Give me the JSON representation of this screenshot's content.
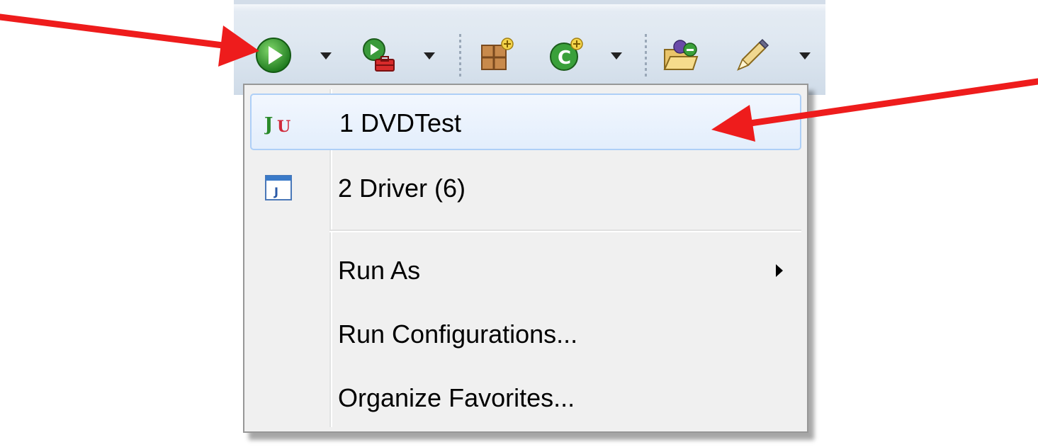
{
  "toolbar": {
    "buttons": [
      {
        "icon": "run-icon",
        "has_dropdown": true
      },
      {
        "icon": "external-tools-icon",
        "has_dropdown": true
      },
      {
        "icon": "new-package-icon",
        "has_dropdown": false
      },
      {
        "icon": "new-class-icon",
        "has_dropdown": true
      },
      {
        "icon": "open-type-icon",
        "has_dropdown": false
      },
      {
        "icon": "search-icon",
        "has_dropdown": true
      }
    ]
  },
  "menu": {
    "items": [
      {
        "label": "1 DVDTest",
        "icon": "junit-icon",
        "selected": true
      },
      {
        "label": "2 Driver (6)",
        "icon": "java-app-icon",
        "selected": false
      },
      {
        "label": "Run As",
        "has_submenu": true
      },
      {
        "label": "Run Configurations..."
      },
      {
        "label": "Organize Favorites..."
      }
    ]
  },
  "colors": {
    "selection_border": "#aecff7",
    "annotation_arrow": "#ee1c1c",
    "menu_background": "#f0f0f0",
    "toolbar_background": "#dfe8f1"
  }
}
